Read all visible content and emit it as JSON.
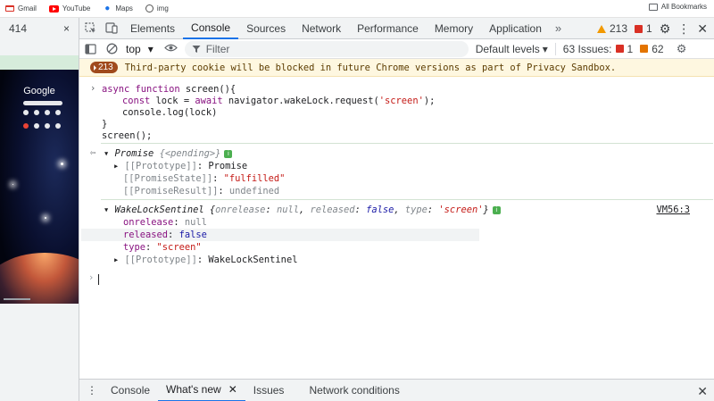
{
  "bookmarks": {
    "items": [
      "Gmail",
      "YouTube",
      "Maps",
      "img"
    ],
    "all_label": "All Bookmarks"
  },
  "left_panel": {
    "counter": "414",
    "close_glyph": "×",
    "google_text": "Google"
  },
  "devtools_tabs": {
    "items": [
      "Elements",
      "Console",
      "Sources",
      "Network",
      "Performance",
      "Memory",
      "Application"
    ],
    "active": "Console",
    "more_glyph": "»",
    "warnings_count": "213",
    "errors_count": "1"
  },
  "toolbar": {
    "context": "top",
    "filter_placeholder": "Filter",
    "levels_label": "Default levels",
    "issues_label": "63 Issues:",
    "issues_red": "1",
    "issues_orange": "62"
  },
  "console": {
    "warning": {
      "badge": "213",
      "text": "Third-party cookie will be blocked in future Chrome versions as part of Privacy Sandbox."
    },
    "code": {
      "l1_kw1": "async",
      "l1_kw2": "function",
      "l1_rest": " screen(){",
      "l2_kw": "const",
      "l2_mid": " lock = ",
      "l2_kw2": "await",
      "l2_call": " navigator.wakeLock.request(",
      "l2_str": "'screen'",
      "l2_end": ");",
      "l3": "console.log(lock)",
      "l4": "}",
      "l5": "screen();"
    },
    "promise": {
      "header_name": "Promise ",
      "header_state": "{<pending>}",
      "proto_key": "[[Prototype]]",
      "proto_val": "Promise",
      "state_key": "[[PromiseState]]",
      "state_val": "\"fulfilled\"",
      "result_key": "[[PromiseResult]]",
      "result_val": "undefined"
    },
    "sentinel": {
      "header_name": "WakeLockSentinel ",
      "h_open": "{",
      "h_k1": "onrelease",
      "h_v1": "null",
      "h_k2": "released",
      "h_v2": "false",
      "h_k3": "type",
      "h_v3": "'screen'",
      "h_close": "}",
      "link": "VM56:3",
      "onrelease_key": "onrelease",
      "onrelease_val": "null",
      "released_key": "released",
      "released_val": "false",
      "type_key": "type",
      "type_val": "\"screen\"",
      "proto_key": "[[Prototype]]",
      "proto_val": "WakeLockSentinel"
    }
  },
  "drawer": {
    "tabs": [
      "Console",
      "What's new",
      "Issues",
      "Network conditions"
    ],
    "active": "What's new"
  }
}
